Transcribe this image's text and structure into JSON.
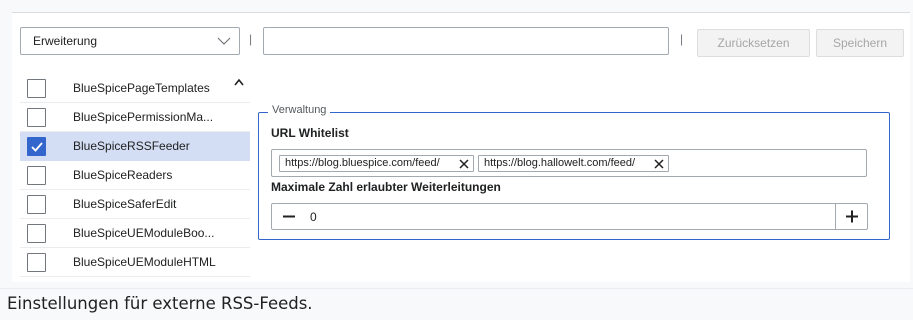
{
  "toolbar": {
    "category_select": "Erweiterung",
    "separator": "|",
    "filter_value": "",
    "reset_label": "Zurücksetzen",
    "save_label": "Speichern"
  },
  "extensions": [
    {
      "label": "BlueSpicePageTemplates",
      "checked": false
    },
    {
      "label": "BlueSpicePermissionMa...",
      "checked": false
    },
    {
      "label": "BlueSpiceRSSFeeder",
      "checked": true
    },
    {
      "label": "BlueSpiceReaders",
      "checked": false
    },
    {
      "label": "BlueSpiceSaferEdit",
      "checked": false
    },
    {
      "label": "BlueSpiceUEModuleBoo...",
      "checked": false
    },
    {
      "label": "BlueSpiceUEModuleHTML",
      "checked": false
    }
  ],
  "settings": {
    "legend": "Verwaltung",
    "whitelist_label": "URL Whitelist",
    "whitelist_tags": [
      "https://blog.bluespice.com/feed/",
      "https://blog.hallowelt.com/feed/"
    ],
    "redirects_label": "Maximale Zahl erlaubter Weiterleitungen",
    "redirects_value": "0"
  },
  "caption": "Einstellungen für externe RSS-Feeds.",
  "colors": {
    "accent": "#3366cc",
    "selected_row": "#d3ddf3",
    "border": "#a2a9b1"
  }
}
